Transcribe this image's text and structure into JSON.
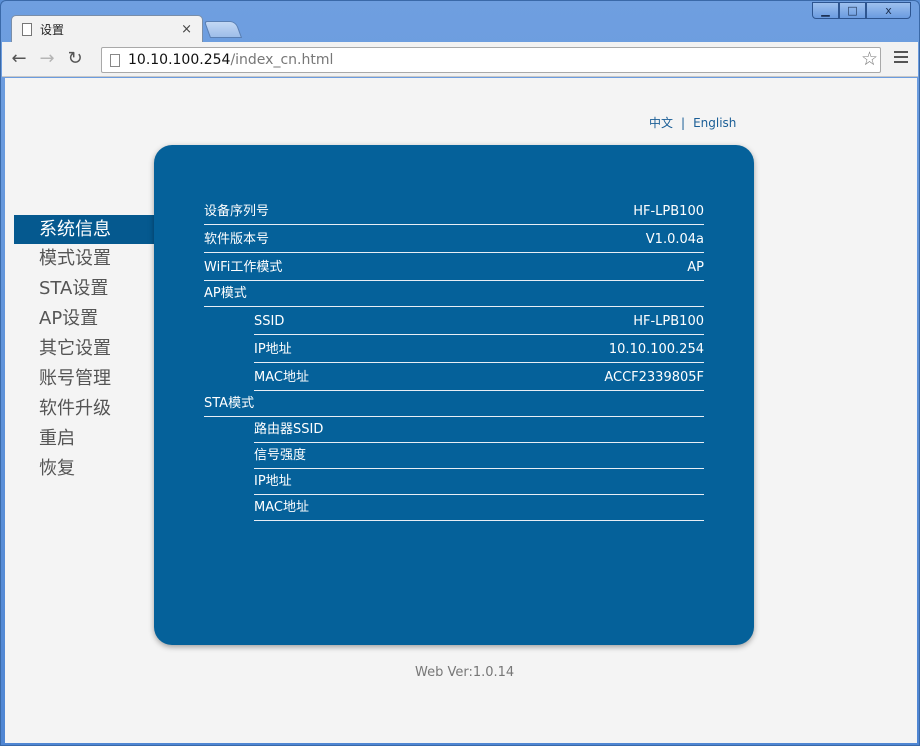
{
  "browser": {
    "tab_title": "设置",
    "tab_close": "×",
    "url_host": "10.10.100.254",
    "url_path": "/index_cn.html",
    "controls": {
      "minimize": "▁",
      "maximize": "□",
      "close": "x"
    }
  },
  "lang": {
    "cn": "中文",
    "sep": "|",
    "en": "English"
  },
  "sidebar": {
    "items": [
      {
        "label": "系统信息"
      },
      {
        "label": "模式设置"
      },
      {
        "label": "STA设置"
      },
      {
        "label": "AP设置"
      },
      {
        "label": "其它设置"
      },
      {
        "label": "账号管理"
      },
      {
        "label": "软件升级"
      },
      {
        "label": "重启"
      },
      {
        "label": "恢复"
      }
    ]
  },
  "info": {
    "serial": {
      "label": "设备序列号",
      "value": "HF-LPB100"
    },
    "version": {
      "label": "软件版本号",
      "value": "V1.0.04a"
    },
    "wifi_mode": {
      "label": "WiFi工作模式",
      "value": "AP"
    },
    "ap_section": {
      "label": "AP模式"
    },
    "ap_ssid": {
      "label": "SSID",
      "value": "HF-LPB100"
    },
    "ap_ip": {
      "label": "IP地址",
      "value": "10.10.100.254"
    },
    "ap_mac": {
      "label": "MAC地址",
      "value": "ACCF2339805F"
    },
    "sta_section": {
      "label": "STA模式"
    },
    "sta_ssid": {
      "label": "路由器SSID",
      "value": ""
    },
    "sta_signal": {
      "label": "信号强度",
      "value": ""
    },
    "sta_ip": {
      "label": "IP地址",
      "value": ""
    },
    "sta_mac": {
      "label": "MAC地址",
      "value": ""
    }
  },
  "footer": {
    "web_ver": "Web Ver:1.0.14"
  },
  "colors": {
    "panel": "#05619a",
    "active": "#05598f",
    "link": "#1a5e96"
  }
}
